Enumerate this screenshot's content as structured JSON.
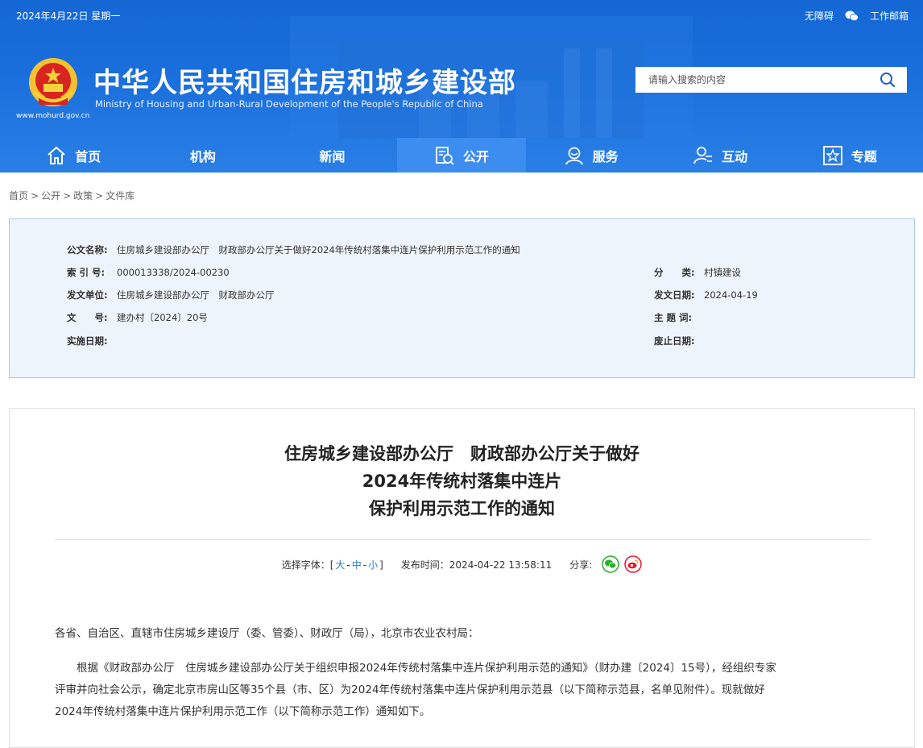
{
  "topbar": {
    "date": "2024年4月22日 星期一",
    "accessibility": "无障碍",
    "mail": "工作邮箱"
  },
  "header": {
    "title": "中华人民共和国住房和城乡建设部",
    "subtitle": "Ministry of Housing and Urban-Rural Development of the People's Republic of China",
    "url": "www.mohurd.gov.cn"
  },
  "search": {
    "placeholder": "请输入搜索的内容"
  },
  "nav": {
    "home": "首页",
    "org": "机构",
    "news": "新闻",
    "open": "公开",
    "service": "服务",
    "interact": "互动",
    "topic": "专题"
  },
  "breadcrumb": {
    "home": "首页",
    "open": "公开",
    "policy": "政策",
    "library": "文件库"
  },
  "info": {
    "name_label": "公文名称:",
    "name_value": "住房城乡建设部办公厅　财政部办公厅关于做好2024年传统村落集中连片保护利用示范工作的通知",
    "index_label": "索 引 号:",
    "index_value": "000013338/2024-00230",
    "category_label": "分　　类:",
    "category_value": "村镇建设",
    "issuer_label": "发文单位:",
    "issuer_value": "住房城乡建设部办公厅　财政部办公厅",
    "date_label": "发文日期:",
    "date_value": "2024-04-19",
    "docno_label": "文　　号:",
    "docno_value": "建办村〔2024〕20号",
    "keywords_label": "主 题 词:",
    "keywords_value": "",
    "effective_label": "实施日期:",
    "effective_value": "",
    "expiry_label": "废止日期:",
    "expiry_value": ""
  },
  "article": {
    "title_line1": "住房城乡建设部办公厅　财政部办公厅关于做好",
    "title_line2": "2024年传统村落集中连片",
    "title_line3": "保护利用示范工作的通知",
    "font_label": "选择字体：[",
    "font_large": "大",
    "font_medium": "中",
    "font_small": "小",
    "font_close": "]",
    "font_dash": "-",
    "publish": "发布时间：2024-04-22 13:58:11",
    "share": "分享:",
    "salutation": "各省、自治区、直辖市住房城乡建设厅（委、管委）、财政厅（局），北京市农业农村局：",
    "para1_line1": "　　根据《财政部办公厅　住房城乡建设部办公厅关于组织申报2024年传统村落集中连片保护利用示范的通知》（财办建〔2024〕15号），经组织专家",
    "para1_line2": "评审并向社会公示，确定北京市房山区等35个县（市、区）为2024年传统村落集中连片保护利用示范县（以下简称示范县，名单见附件）。现就做好",
    "para1_line3": "2024年传统村落集中连片保护利用示范工作（以下简称示范工作）通知如下。"
  },
  "colors": {
    "header_blue": "#1a6fdc",
    "nav_active": "#3d8cf0",
    "info_bg": "#eef4fb",
    "link": "#2d78d4",
    "wechat": "#2aae2c",
    "weibo": "#e6162d"
  }
}
